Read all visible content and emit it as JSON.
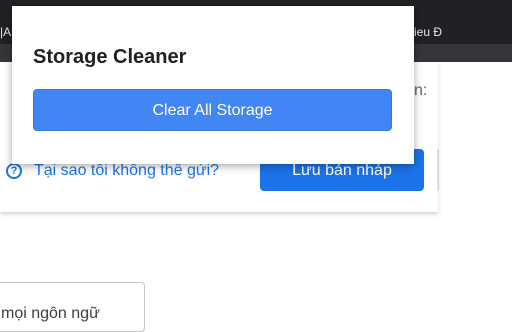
{
  "browser": {
    "tab_fragment_left": "|A",
    "tab_fragment_right": "ieu Đ"
  },
  "page": {
    "label_fragment": "n:",
    "help_link": "Tại sao tôi không thể gửi?",
    "help_icon": "question-circle-icon",
    "draft_button": "Lưu bản nháp",
    "language_field_value": "mọi ngôn ngữ"
  },
  "popup": {
    "title": "Storage Cleaner",
    "clear_button": "Clear All Storage"
  },
  "colors": {
    "tabstrip": "#202124",
    "primary_button": "#1a73e8",
    "popup_button": "#4285f4"
  }
}
